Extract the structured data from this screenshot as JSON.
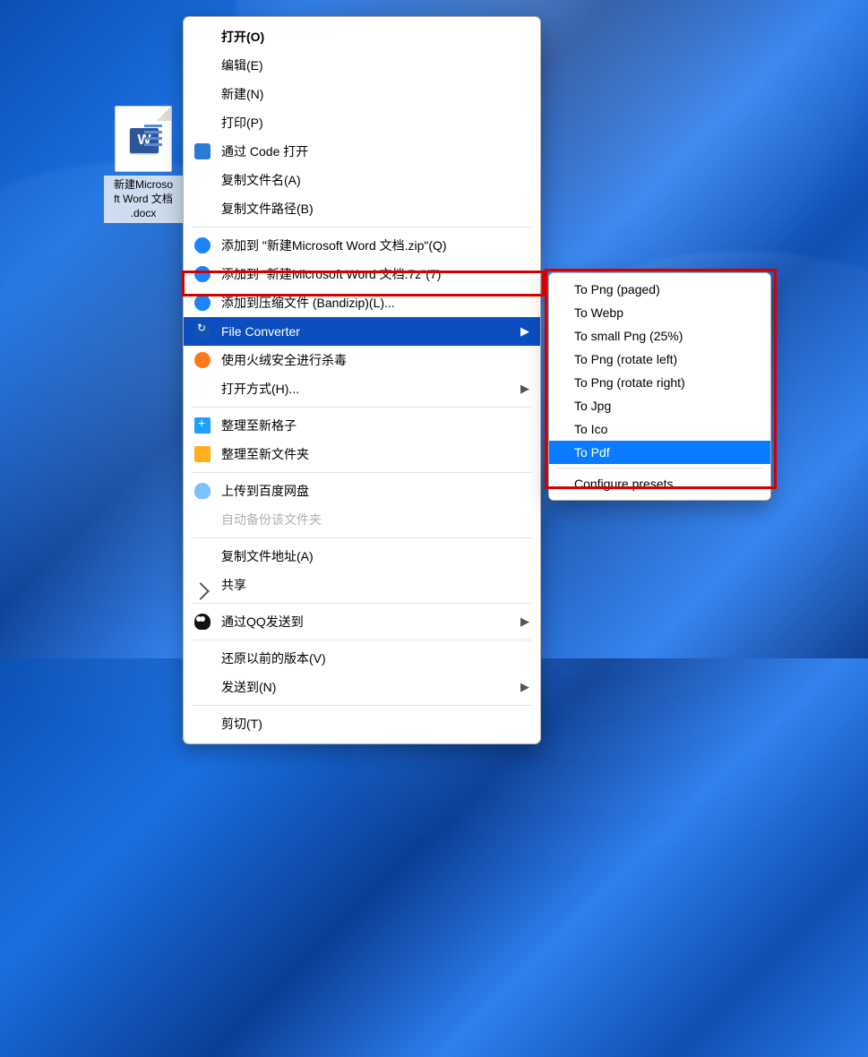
{
  "desktop_file": {
    "name_line1": "新建Microso",
    "name_line2": "ft Word 文档",
    "name_line3": ".docx",
    "word_letter": "W"
  },
  "context_menu": {
    "items": [
      {
        "label": "打开(O)",
        "bold": true
      },
      {
        "label": "编辑(E)"
      },
      {
        "label": "新建(N)"
      },
      {
        "label": "打印(P)"
      },
      {
        "label": "通过 Code 打开",
        "icon": "code"
      },
      {
        "label": "复制文件名(A)"
      },
      {
        "label": "复制文件路径(B)"
      },
      {
        "sep": true
      },
      {
        "label": "添加到 \"新建Microsoft Word 文档.zip\"(Q)",
        "icon": "ball blue"
      },
      {
        "label": "添加到 \"新建Microsoft Word 文档.7z\"(7)",
        "icon": "ball blue"
      },
      {
        "label": "添加到压缩文件 (Bandizip)(L)...",
        "icon": "ball blue"
      },
      {
        "label": "File Converter",
        "icon": "conv",
        "submenu": true,
        "highlight": true
      },
      {
        "label": "使用火绒安全进行杀毒",
        "icon": "ball"
      },
      {
        "label": "打开方式(H)...",
        "submenu": true
      },
      {
        "sep": true
      },
      {
        "label": "整理至新格子",
        "icon": "plus"
      },
      {
        "label": "整理至新文件夹",
        "icon": "folder"
      },
      {
        "sep": true
      },
      {
        "label": "上传到百度网盘",
        "icon": "cloud"
      },
      {
        "label": "自动备份该文件夹",
        "disabled": true
      },
      {
        "sep": true
      },
      {
        "label": "复制文件地址(A)"
      },
      {
        "label": "共享",
        "icon": "share"
      },
      {
        "sep": true
      },
      {
        "label": "通过QQ发送到",
        "icon": "qq",
        "submenu": true
      },
      {
        "sep": true
      },
      {
        "label": "还原以前的版本(V)"
      },
      {
        "label": "发送到(N)",
        "submenu": true
      },
      {
        "sep": true
      },
      {
        "label": "剪切(T)"
      }
    ]
  },
  "submenu": {
    "items": [
      {
        "label": "To Png (paged)"
      },
      {
        "label": "To Webp"
      },
      {
        "label": "To small Png (25%)"
      },
      {
        "label": "To Png (rotate left)"
      },
      {
        "label": "To Png (rotate right)"
      },
      {
        "label": "To Jpg"
      },
      {
        "label": "To Ico"
      },
      {
        "label": "To Pdf",
        "highlight": true
      },
      {
        "sep": true
      },
      {
        "label": "Configure presets..."
      }
    ]
  }
}
